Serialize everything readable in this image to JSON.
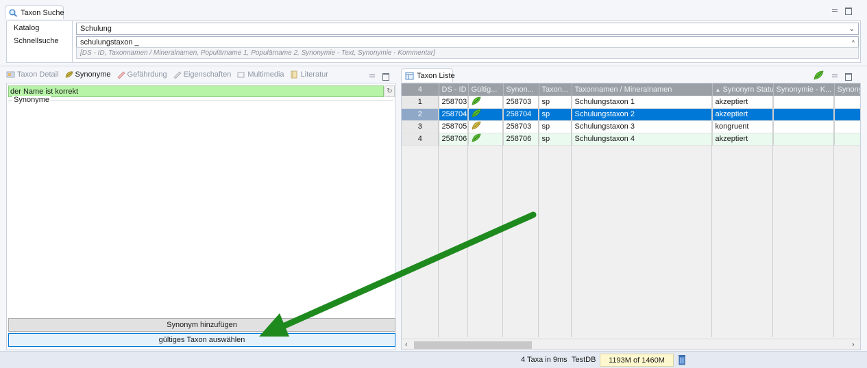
{
  "search_part": {
    "tab_label": "Taxon Suche",
    "katalog_label": "Katalog",
    "katalog_value": "Schulung",
    "schnellsuche_label": "Schnellsuche",
    "schnellsuche_value": "schulungstaxon _",
    "schnellsuche_hint": "[DS - ID, Taxonnamen / Mineralnamen, Populärname  1, Populärname  2, Synonymie - Text, Synonymie - Kommentar]"
  },
  "left_part": {
    "tabs": [
      {
        "label": "Taxon Detail",
        "icon": "taxon-detail-icon",
        "active": false
      },
      {
        "label": "Synonyme",
        "icon": "synonyme-icon",
        "active": true
      },
      {
        "label": "Gefährdung",
        "icon": "gefaehrdung-icon",
        "active": false
      },
      {
        "label": "Eigenschaften",
        "icon": "eigenschaften-icon",
        "active": false
      },
      {
        "label": "Multimedia",
        "icon": "multimedia-icon",
        "active": false
      },
      {
        "label": "Literatur",
        "icon": "literatur-icon",
        "active": false
      }
    ],
    "status_text": "der Name ist korrekt",
    "status_color": "#b8f4a8",
    "synonyme_group_label": "Synonyme",
    "add_button": "Synonym hinzufügen",
    "valid_button": "gültiges Taxon auswählen"
  },
  "right_part": {
    "tab_label": "Taxon Liste",
    "columns": [
      "4",
      "DS - ID",
      "Gültig...",
      "Synon...",
      "Taxon...",
      "Taxonnamen / Mineralnamen",
      "Synonym Status",
      "Synonymie - K...",
      "Synony"
    ],
    "sort_column_index": 6,
    "rows": [
      {
        "num": "1",
        "id": "258703",
        "valid": true,
        "syn": "258703",
        "taxon": "sp",
        "name": "Schulungstaxon 1",
        "status": "akzeptiert",
        "selected": false,
        "alt": false
      },
      {
        "num": "2",
        "id": "258704",
        "valid": true,
        "syn": "258704",
        "taxon": "sp",
        "name": "Schulungstaxon 2",
        "status": "akzeptiert",
        "selected": true,
        "alt": false
      },
      {
        "num": "3",
        "id": "258705",
        "valid": false,
        "syn": "258703",
        "taxon": "sp",
        "name": "Schulungstaxon 3",
        "status": "kongruent",
        "selected": false,
        "alt": false
      },
      {
        "num": "4",
        "id": "258706",
        "valid": true,
        "syn": "258706",
        "taxon": "sp",
        "name": "Schulungstaxon 4",
        "status": "akzeptiert",
        "selected": false,
        "alt": true
      }
    ]
  },
  "status_bar": {
    "count_text": "4 Taxa in 9ms",
    "db_name": "TestDB",
    "memory": "1193M of 1460M"
  },
  "colors": {
    "selection": "#0078d7",
    "leaf_green": "#4caf2a",
    "annotation_arrow": "#1e8a1e"
  }
}
